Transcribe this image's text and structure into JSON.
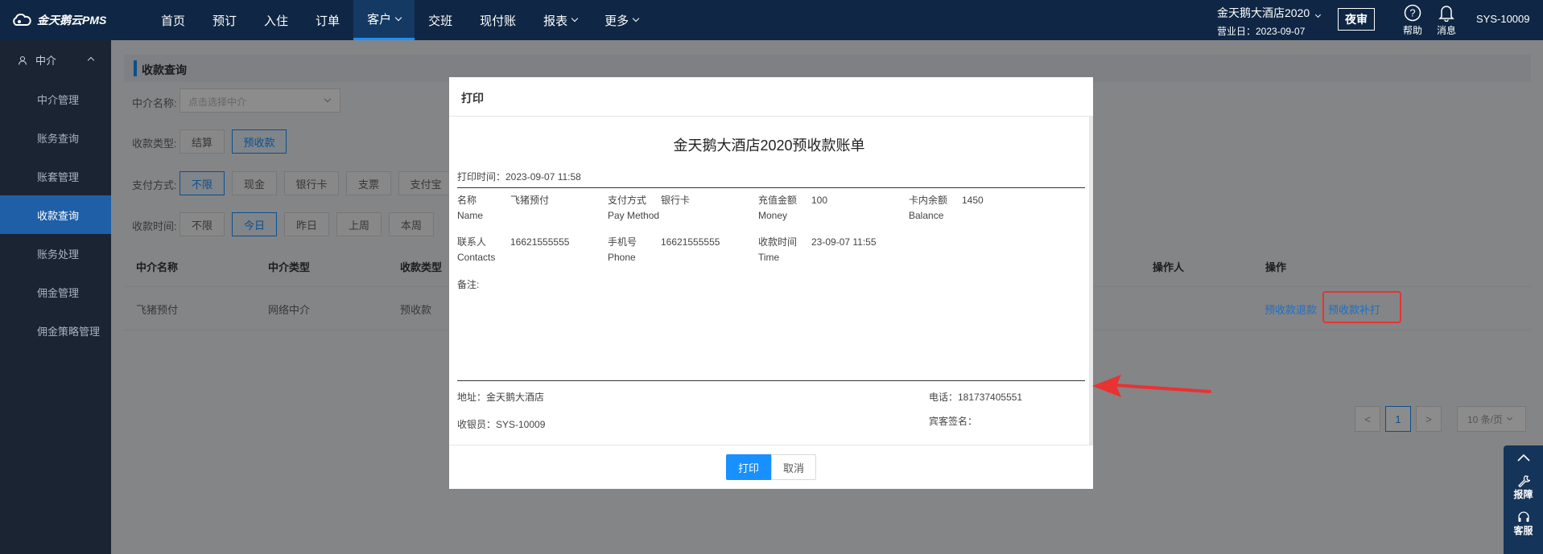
{
  "app": {
    "logo_text": "金天鹅云PMS"
  },
  "nav": {
    "items": [
      {
        "label": "首页"
      },
      {
        "label": "预订"
      },
      {
        "label": "入住"
      },
      {
        "label": "订单"
      },
      {
        "label": "客户"
      },
      {
        "label": "交班"
      },
      {
        "label": "现付账"
      },
      {
        "label": "报表"
      },
      {
        "label": "更多"
      }
    ],
    "active": "客户"
  },
  "header": {
    "hotel_name": "金天鹅大酒店2020",
    "business_day": "营业日：2023-09-07",
    "night_audit": "夜审",
    "help": "帮助",
    "messages": "消息",
    "user": "SYS-10009"
  },
  "sidebar": {
    "group": "中介",
    "items": [
      {
        "label": "中介管理"
      },
      {
        "label": "账务查询"
      },
      {
        "label": "账套管理"
      },
      {
        "label": "收款查询"
      },
      {
        "label": "账务处理"
      },
      {
        "label": "佣金管理"
      },
      {
        "label": "佣金策略管理"
      }
    ],
    "active": "收款查询"
  },
  "page": {
    "title": "收款查询",
    "filters": {
      "agent_label": "中介名称:",
      "agent_placeholder": "点击选择中介",
      "type_label": "收款类型:",
      "types": [
        "结算",
        "预收款"
      ],
      "pay_label": "支付方式:",
      "pays": [
        "不限",
        "现金",
        "银行卡",
        "支票",
        "支付宝"
      ],
      "time_label": "收款时间:",
      "times": [
        "不限",
        "今日",
        "昨日",
        "上周",
        "本周"
      ]
    },
    "table": {
      "headers": [
        "中介名称",
        "中介类型",
        "收款类型",
        "操作人",
        "操作"
      ],
      "row": [
        "飞猪预付",
        "网络中介",
        "预收款"
      ],
      "actions": [
        "预收款退款",
        "预收款补打"
      ]
    },
    "pagination": {
      "current": "1",
      "prev": "<",
      "next": ">",
      "page_size": "10 条/页"
    }
  },
  "modal": {
    "title": "打印",
    "doc_title": "金天鹅大酒店2020预收款账单",
    "print_time": "打印时间：2023-09-07 11:58",
    "fields": {
      "name_cn": "名称",
      "name_en": "Name",
      "name_val": "飞猪预付",
      "pay_cn": "支付方式",
      "pay_en": "Pay Method",
      "pay_val": "银行卡",
      "money_cn": "充值金额",
      "money_en": "Money",
      "money_val": "100",
      "balance_cn": "卡内余额",
      "balance_en": "Balance",
      "balance_val": "1450",
      "contact_cn": "联系人",
      "contact_en": "Contacts",
      "contact_val": "16621555555",
      "phone_cn": "手机号",
      "phone_en": "Phone",
      "phone_val": "16621555555",
      "time_cn": "收款时间",
      "time_en": "Time",
      "time_val": "23-09-07 11:55",
      "remark": "备注:"
    },
    "footer_info": {
      "address": "地址：金天鹅大酒店",
      "tel": "电话：181737405551",
      "cashier": "收银员：SYS-10009",
      "guest_sign": "宾客签名："
    },
    "buttons": {
      "print": "打印",
      "cancel": "取消"
    }
  },
  "float": {
    "report": "报障",
    "service": "客服"
  },
  "colors": {
    "topbar": "#0f2744",
    "sidebar": "#1b2433",
    "primary": "#1890ff",
    "highlight": "#ea3232"
  }
}
